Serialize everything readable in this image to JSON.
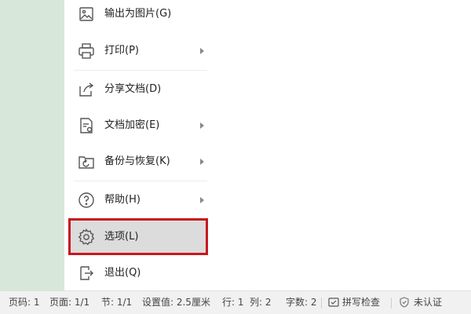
{
  "menu": {
    "items": [
      {
        "id": "export-image",
        "label": "输出为图片(G)",
        "icon": "image-export-icon",
        "has_submenu": false
      },
      {
        "id": "print",
        "label": "打印(P)",
        "icon": "printer-icon",
        "has_submenu": true
      },
      {
        "id": "share",
        "label": "分享文档(D)",
        "icon": "share-icon",
        "has_submenu": false
      },
      {
        "id": "encrypt",
        "label": "文档加密(E)",
        "icon": "document-lock-icon",
        "has_submenu": true
      },
      {
        "id": "backup",
        "label": "备份与恢复(K)",
        "icon": "backup-restore-icon",
        "has_submenu": true
      },
      {
        "id": "help",
        "label": "帮助(H)",
        "icon": "help-icon",
        "has_submenu": true
      },
      {
        "id": "options",
        "label": "选项(L)",
        "icon": "gear-icon",
        "has_submenu": false,
        "highlighted": true
      },
      {
        "id": "exit",
        "label": "退出(Q)",
        "icon": "exit-icon",
        "has_submenu": false
      }
    ]
  },
  "status_bar": {
    "page_code": "页码: 1",
    "page": "页面: 1/1",
    "section": "节: 1/1",
    "setting_value": "设置值: 2.5厘米",
    "row": "行: 1",
    "column": "列: 2",
    "word_count": "字数: 2",
    "spell_check": "拼写检查",
    "certification": "未认证"
  },
  "colors": {
    "left_strip": "#d7e8da",
    "highlight_border": "#c8161d",
    "highlight_fill": "#dcdcdc",
    "status_bar_bg": "#f1f1f1"
  }
}
